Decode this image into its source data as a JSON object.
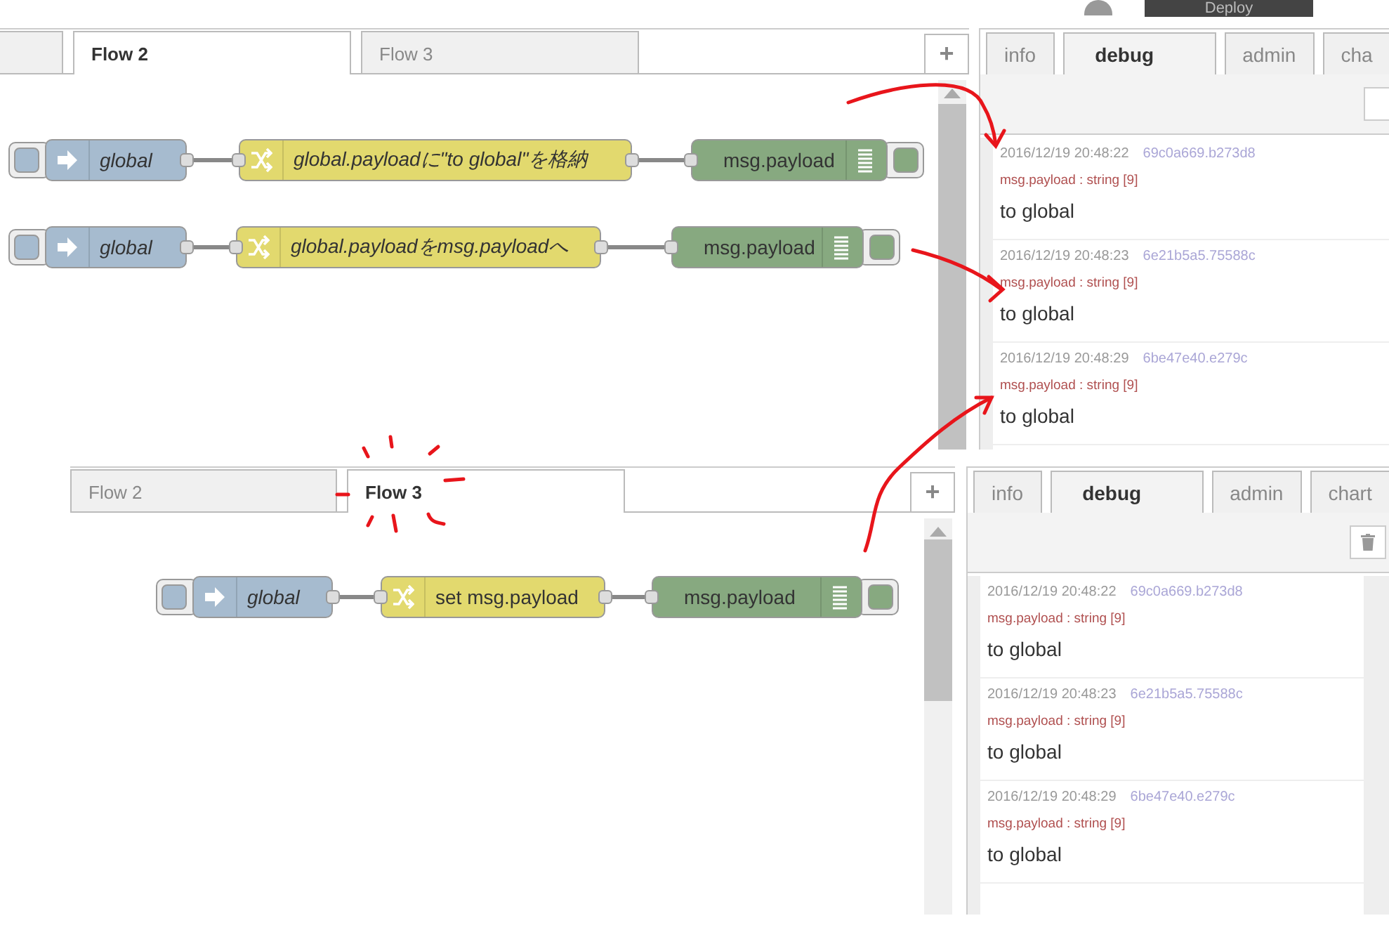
{
  "screens": [
    {
      "header": {
        "deploy": "Deploy"
      },
      "leading_tab_fragment": true,
      "flow_tabs": [
        {
          "label": "Flow 2",
          "selected": true
        },
        {
          "label": "Flow 3",
          "selected": false
        }
      ],
      "add_tab": "+",
      "rows": [
        {
          "nodes": [
            {
              "kind": "inject",
              "label": "global",
              "italic": true
            },
            {
              "kind": "change",
              "label": "global.payloadに\"to global\"を格納",
              "italic": true
            },
            {
              "kind": "debug",
              "label": "msg.payload",
              "italic": false
            }
          ]
        },
        {
          "nodes": [
            {
              "kind": "inject",
              "label": "global",
              "italic": true
            },
            {
              "kind": "change",
              "label": "global.payloadをmsg.payloadへ",
              "italic": true
            },
            {
              "kind": "debug",
              "label": "msg.payload",
              "italic": false
            }
          ]
        }
      ],
      "sidebar": {
        "tabs": [
          {
            "label": "info",
            "selected": false
          },
          {
            "label": "debug",
            "selected": true
          },
          {
            "label": "admin",
            "selected": false
          },
          {
            "label": "cha",
            "selected": false
          }
        ],
        "trash_icon": false,
        "messages": [
          {
            "time": "2016/12/19 20:48:22",
            "node_id": "69c0a669.b273d8",
            "topic": "msg.payload : string [9]",
            "value": "to global"
          },
          {
            "time": "2016/12/19 20:48:23",
            "node_id": "6e21b5a5.75588c",
            "topic": "msg.payload : string [9]",
            "value": "to global"
          },
          {
            "time": "2016/12/19 20:48:29",
            "node_id": "6be47e40.e279c",
            "topic": "msg.payload : string [9]",
            "value": "to global"
          }
        ]
      }
    },
    {
      "leading_tab_fragment": false,
      "flow_tabs": [
        {
          "label": "Flow 2",
          "selected": false
        },
        {
          "label": "Flow 3",
          "selected": true
        }
      ],
      "add_tab": "+",
      "rows": [
        {
          "nodes": [
            {
              "kind": "inject",
              "label": "global",
              "italic": true
            },
            {
              "kind": "change",
              "label": "set msg.payload",
              "italic": false
            },
            {
              "kind": "debug",
              "label": "msg.payload",
              "italic": false
            }
          ]
        }
      ],
      "sidebar": {
        "tabs": [
          {
            "label": "info",
            "selected": false
          },
          {
            "label": "debug",
            "selected": true
          },
          {
            "label": "admin",
            "selected": false
          },
          {
            "label": "chart",
            "selected": false
          }
        ],
        "trash_icon": true,
        "messages": [
          {
            "time": "2016/12/19 20:48:22",
            "node_id": "69c0a669.b273d8",
            "topic": "msg.payload : string [9]",
            "value": "to global"
          },
          {
            "time": "2016/12/19 20:48:23",
            "node_id": "6e21b5a5.75588c",
            "topic": "msg.payload : string [9]",
            "value": "to global"
          },
          {
            "time": "2016/12/19 20:48:29",
            "node_id": "6be47e40.e279c",
            "topic": "msg.payload : string [9]",
            "value": "to global"
          }
        ]
      }
    }
  ]
}
